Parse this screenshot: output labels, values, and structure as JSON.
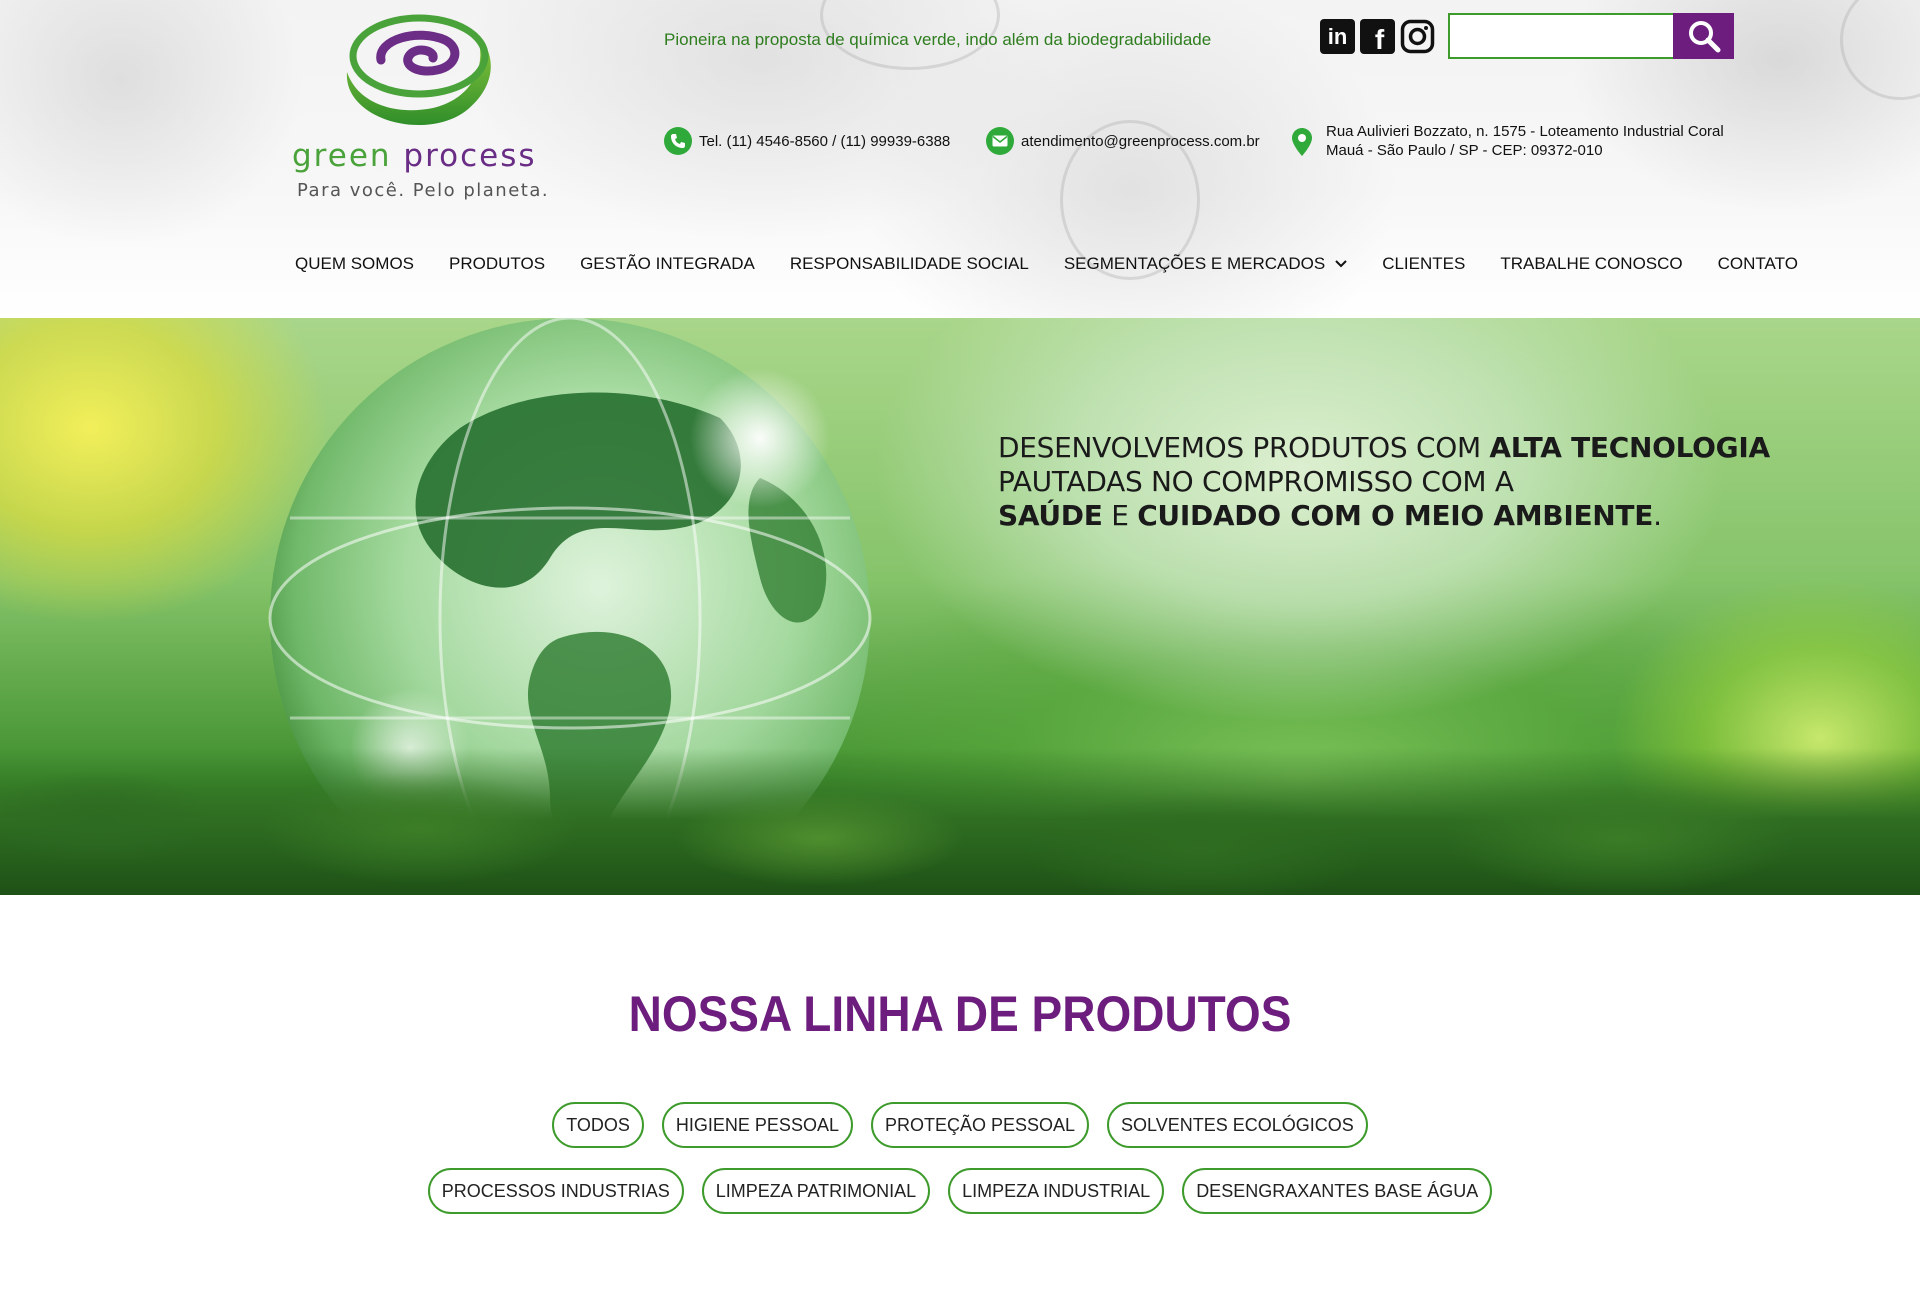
{
  "header": {
    "logo": {
      "brand_green": "green",
      "brand_purple": "process",
      "tagline": "Para você.  Pelo planeta."
    },
    "tagline": "Pioneira na proposta de química verde, indo além da biodegradabilidade",
    "social": {
      "linkedin": "in",
      "facebook": "f"
    },
    "search": {
      "value": "",
      "placeholder": ""
    },
    "contact": {
      "phone": "Tel. (11) 4546-8560 / (11) 99939-6388",
      "email": "atendimento@greenprocess.com.br",
      "address_line1": "Rua Aulivieri Bozzato, n. 1575 - Loteamento Industrial Coral",
      "address_line2": "Mauá - São Paulo / SP - CEP: 09372-010"
    },
    "nav": {
      "quem_somos": "QUEM SOMOS",
      "produtos": "PRODUTOS",
      "gestao": "GESTÃO INTEGRADA",
      "responsabilidade": "RESPONSABILIDADE SOCIAL",
      "segmentacoes": "SEGMENTAÇÕES E MERCADOS",
      "clientes": "CLIENTES",
      "trabalhe": "TRABALHE CONOSCO",
      "contato": "CONTATO"
    }
  },
  "hero": {
    "l1_normal": "DESENVOLVEMOS PRODUTOS COM ",
    "l1_bold": "ALTA TECNOLOGIA",
    "l2_normal": "PAUTADAS NO COMPROMISSO COM A",
    "l3_bold_a": "SAÚDE",
    "l3_normal": " E ",
    "l3_bold_b": "CUIDADO COM O MEIO AMBIENTE",
    "l3_end": "."
  },
  "products": {
    "title": "NOSSA LINHA DE PRODUTOS",
    "filters_row1": [
      "TODOS",
      "HIGIENE PESSOAL",
      "PROTEÇÃO PESSOAL",
      "SOLVENTES ECOLÓGICOS"
    ],
    "filters_row2": [
      "PROCESSOS INDUSTRIAS",
      "LIMPEZA PATRIMONIAL",
      "LIMPEZA INDUSTRIAL",
      "DESENGRAXANTES BASE ÁGUA"
    ]
  },
  "colors": {
    "green": "#3d9b2b",
    "purple": "#6c1d7d",
    "icon_green": "#2faa3a"
  }
}
